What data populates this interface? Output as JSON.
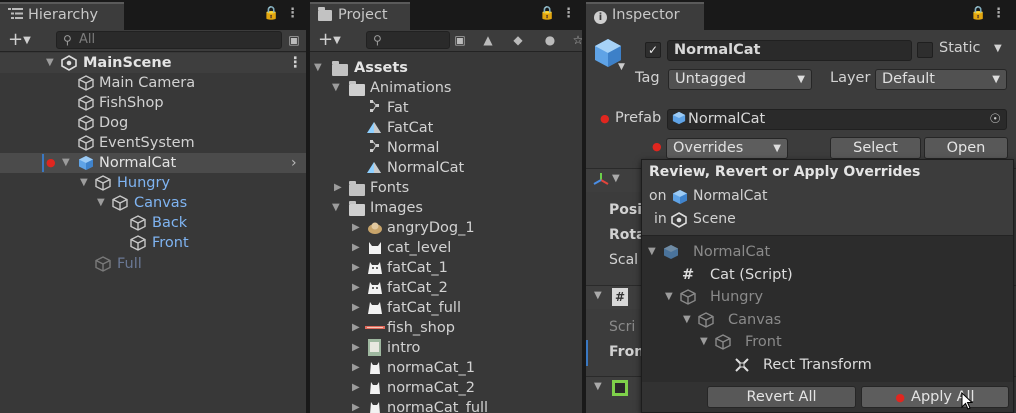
{
  "hierarchy": {
    "tab_title": "Hierarchy",
    "search_placeholder": "All",
    "scene_name": "MainScene",
    "items": [
      {
        "label": "Main Camera"
      },
      {
        "label": "FishShop"
      },
      {
        "label": "Dog"
      },
      {
        "label": "EventSystem"
      },
      {
        "label": "NormalCat"
      },
      {
        "label": "Hungry"
      },
      {
        "label": "Canvas"
      },
      {
        "label": "Back"
      },
      {
        "label": "Front"
      },
      {
        "label": "Full"
      }
    ]
  },
  "project": {
    "tab_title": "Project",
    "badge_count": "",
    "tree": [
      {
        "label": "Assets"
      },
      {
        "label": "Animations"
      },
      {
        "label": "Fat"
      },
      {
        "label": "FatCat"
      },
      {
        "label": "Normal"
      },
      {
        "label": "NormalCat"
      },
      {
        "label": "Fonts"
      },
      {
        "label": "Images"
      },
      {
        "label": "angryDog_1"
      },
      {
        "label": "cat_level"
      },
      {
        "label": "fatCat_1"
      },
      {
        "label": "fatCat_2"
      },
      {
        "label": "fatCat_full"
      },
      {
        "label": "fish_shop"
      },
      {
        "label": "intro"
      },
      {
        "label": "normaCat_1"
      },
      {
        "label": "normaCat_2"
      },
      {
        "label": "normaCat_full"
      }
    ]
  },
  "inspector": {
    "tab_title": "Inspector",
    "object_name": "NormalCat",
    "static_label": "Static",
    "tag_label": "Tag",
    "tag_value": "Untagged",
    "layer_label": "Layer",
    "layer_value": "Default",
    "prefab_label": "Prefab",
    "prefab_value": "NormalCat",
    "overrides_label": "Overrides",
    "select_label": "Select",
    "open_label": "Open",
    "component_rows": [
      "Posi",
      "Rota",
      "Scal"
    ],
    "script_label": "Scri",
    "front_label": "Fron"
  },
  "overrides_popup": {
    "title": "Review, Revert or Apply Overrides",
    "on_label": "on",
    "on_value": "NormalCat",
    "in_label": "in",
    "in_value": "Scene",
    "tree": [
      {
        "label": "NormalCat"
      },
      {
        "label": "Cat (Script)"
      },
      {
        "label": "Hungry"
      },
      {
        "label": "Canvas"
      },
      {
        "label": "Front"
      },
      {
        "label": "Rect Transform"
      }
    ],
    "revert_all_label": "Revert All",
    "apply_all_label": "Apply All"
  },
  "colors": {
    "prefab_blue": "#7fb4f2",
    "override_red": "#e0261f",
    "panel_bg": "#383838"
  }
}
